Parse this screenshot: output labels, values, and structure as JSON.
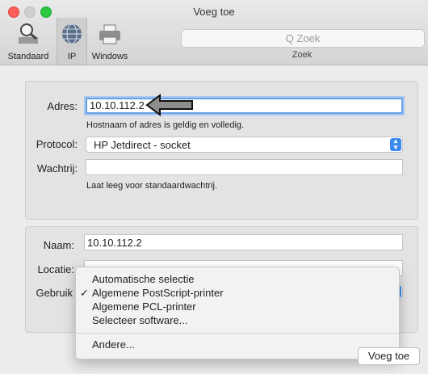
{
  "window": {
    "title": "Voeg toe"
  },
  "toolbar": {
    "items": [
      {
        "label": "Standaard"
      },
      {
        "label": "IP"
      },
      {
        "label": "Windows"
      }
    ],
    "search_placeholder": "Q Zoek",
    "search_label": "Zoek"
  },
  "form": {
    "adres_label": "Adres:",
    "adres_value": "10.10.112.2",
    "adres_hint": "Hostnaam of adres is geldig en volledig.",
    "protocol_label": "Protocol:",
    "protocol_value": "HP Jetdirect - socket",
    "wachtrij_label": "Wachtrij:",
    "wachtrij_value": "",
    "wachtrij_hint": "Laat leeg voor standaardwachtrij.",
    "naam_label": "Naam:",
    "naam_value": "10.10.112.2",
    "locatie_label": "Locatie:",
    "gebruik_label": "Gebruik"
  },
  "menu": {
    "items": [
      {
        "label": "Automatische selectie",
        "checked": false
      },
      {
        "label": "Algemene PostScript-printer",
        "checked": true
      },
      {
        "label": "Algemene PCL-printer",
        "checked": false
      },
      {
        "label": "Selecteer software...",
        "checked": false
      },
      {
        "label": "Andere...",
        "checked": false
      }
    ],
    "check_mark": "✓"
  },
  "footer": {
    "add_button": "Voeg toe"
  }
}
